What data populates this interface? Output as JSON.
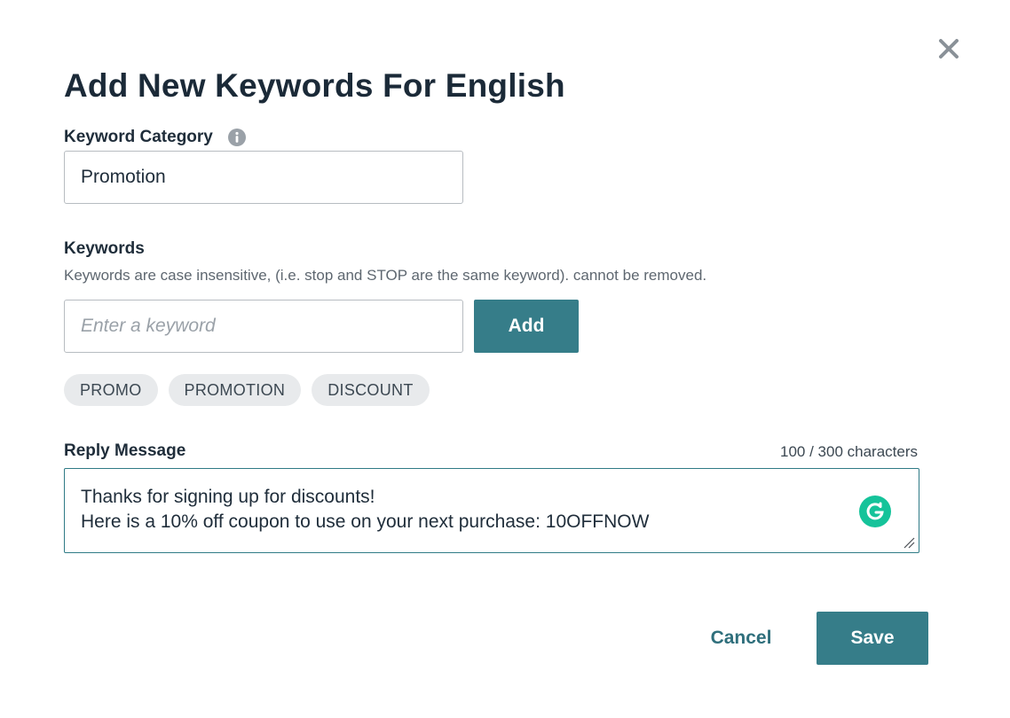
{
  "dialog": {
    "title": "Add New Keywords For English"
  },
  "category": {
    "label": "Keyword Category",
    "value": "Promotion"
  },
  "keywords": {
    "label": "Keywords",
    "helper": "Keywords are case insensitive, (i.e. stop and STOP are the same keyword). cannot be removed.",
    "placeholder": "Enter a keyword",
    "add_label": "Add",
    "chips": [
      "PROMO",
      "PROMOTION",
      "DISCOUNT"
    ]
  },
  "reply": {
    "label": "Reply Message",
    "count": "100 / 300 characters",
    "line1": "Thanks for signing up for discounts!",
    "line2": "Here is a 10% off coupon to use on your next purchase: 10OFFNOW"
  },
  "actions": {
    "cancel_label": "Cancel",
    "save_label": "Save"
  },
  "colors": {
    "primary": "#367d89",
    "chip_bg": "#e8eaec",
    "grammarly": "#15c39a"
  },
  "icons": {
    "close": "close-icon",
    "info": "info-icon",
    "grammarly": "grammarly-icon",
    "resize": "resize-handle-icon"
  }
}
